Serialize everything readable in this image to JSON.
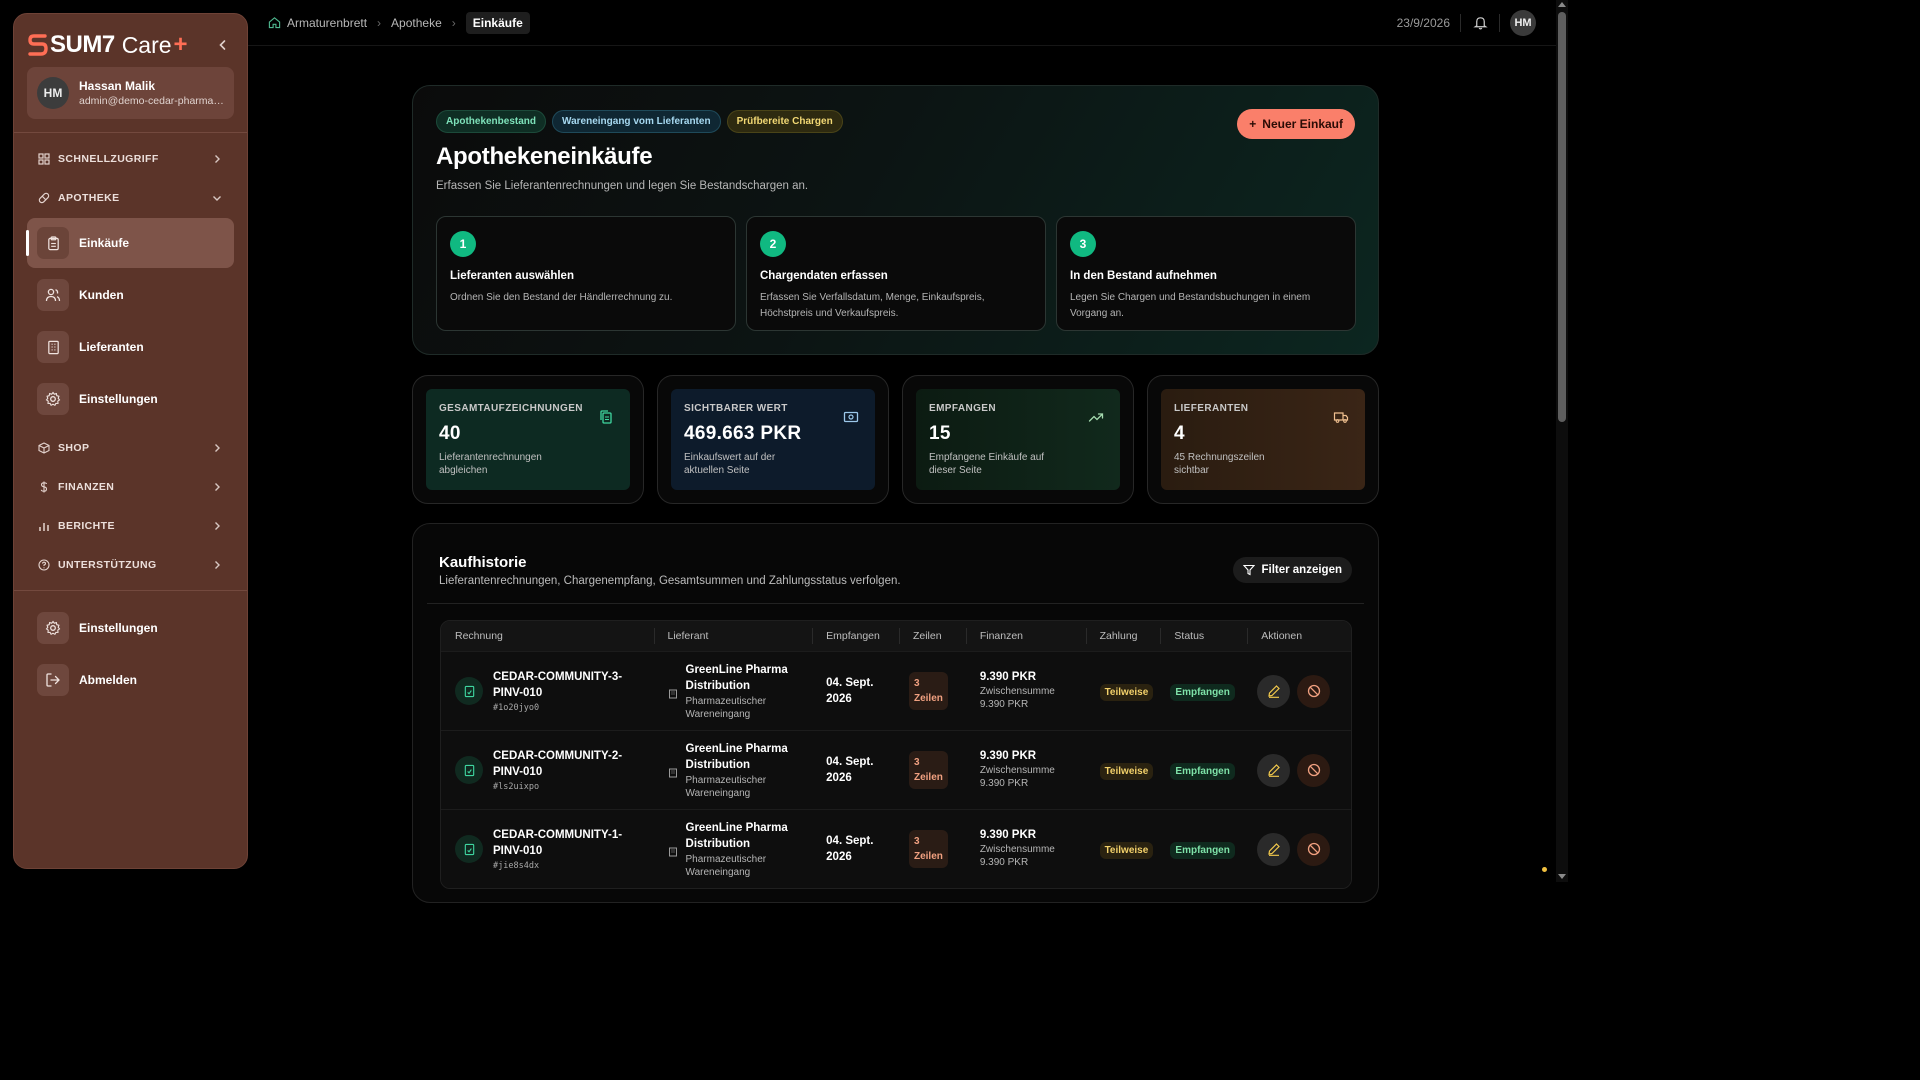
{
  "brand": {
    "name": "SUM7",
    "product": "Care",
    "plus": "+"
  },
  "user": {
    "initials": "HM",
    "name": "Hassan Malik",
    "email": "admin@demo-cedar-pharmacy...."
  },
  "sidebar": {
    "quick_access": "SCHNELLZUGRIFF",
    "pharmacy": "APOTHEKE",
    "pharmacy_items": [
      {
        "label": "Einkäufe",
        "icon": "clipboard-icon"
      },
      {
        "label": "Kunden",
        "icon": "users-icon"
      },
      {
        "label": "Lieferanten",
        "icon": "building-icon"
      },
      {
        "label": "Einstellungen",
        "icon": "gear-icon"
      }
    ],
    "sections": [
      "SHOP",
      "FINANZEN",
      "BERICHTE",
      "UNTERSTÜTZUNG"
    ],
    "bottom_items": [
      {
        "label": "Einstellungen",
        "icon": "gear-icon"
      },
      {
        "label": "Abmelden",
        "icon": "logout-icon"
      }
    ]
  },
  "breadcrumb": [
    "Armaturenbrett",
    "Apotheke",
    "Einkäufe"
  ],
  "topbar": {
    "date": "23/9/2026",
    "avatar": "HM"
  },
  "hero": {
    "chips": [
      "Apothekenbestand",
      "Wareneingang vom Lieferanten",
      "Prüfbereite Chargen"
    ],
    "title": "Apothekeneinkäufe",
    "subtitle": "Erfassen Sie Lieferantenrechnungen und legen Sie Bestandschargen an.",
    "new_button": "Neuer Einkauf",
    "steps": [
      {
        "num": "1",
        "title": "Lieferanten auswählen",
        "text": "Ordnen Sie den Bestand der Händlerrechnung zu."
      },
      {
        "num": "2",
        "title": "Chargendaten erfassen",
        "text": "Erfassen Sie Verfallsdatum, Menge, Einkaufspreis, Höchstpreis und Verkaufspreis."
      },
      {
        "num": "3",
        "title": "In den Bestand aufnehmen",
        "text": "Legen Sie Chargen und Bestandsbuchungen in einem Vorgang an."
      }
    ]
  },
  "stats": [
    {
      "label": "GESAMTAUFZEICHNUNGEN",
      "value": "40",
      "desc": "Lieferantenrechnungen abgleichen",
      "icon": "copy-icon"
    },
    {
      "label": "SICHTBARER WERT",
      "value": "469.663 PKR",
      "desc": "Einkaufswert auf der aktuellen Seite",
      "icon": "banknote-icon"
    },
    {
      "label": "EMPFANGEN",
      "value": "15",
      "desc": "Empfangene Einkäufe auf dieser Seite",
      "icon": "trend-up-icon"
    },
    {
      "label": "LIEFERANTEN",
      "value": "4",
      "desc": "45 Rechnungszeilen sichtbar",
      "icon": "truck-icon"
    }
  ],
  "history": {
    "title": "Kaufhistorie",
    "subtitle": "Lieferantenrechnungen, Chargenempfang, Gesamtsummen und Zahlungsstatus verfolgen.",
    "filter_button": "Filter anzeigen",
    "columns": [
      "Rechnung",
      "Lieferant",
      "Empfangen",
      "Zeilen",
      "Finanzen",
      "Zahlung",
      "Status",
      "Aktionen"
    ],
    "rows": [
      {
        "invoice_l1": "CEDAR-COMMUNITY-3-",
        "invoice_l2": "PINV-010",
        "id": "#1o20jyo0",
        "supplier_l1": "GreenLine Pharma",
        "supplier_l2": "Distribution",
        "type_l1": "Pharmazeutischer",
        "type_l2": "Wareneingang",
        "date_l1": "04. Sept.",
        "date_l2": "2026",
        "lines_l1": "3",
        "lines_l2": "Zeilen",
        "amount": "9.390 PKR",
        "sub_l1": "Zwischensumme",
        "sub_l2": "9.390 PKR",
        "payment": "Teilweise",
        "status": "Empfangen"
      },
      {
        "invoice_l1": "CEDAR-COMMUNITY-2-",
        "invoice_l2": "PINV-010",
        "id": "#ls2uixpo",
        "supplier_l1": "GreenLine Pharma",
        "supplier_l2": "Distribution",
        "type_l1": "Pharmazeutischer",
        "type_l2": "Wareneingang",
        "date_l1": "04. Sept.",
        "date_l2": "2026",
        "lines_l1": "3",
        "lines_l2": "Zeilen",
        "amount": "9.390 PKR",
        "sub_l1": "Zwischensumme",
        "sub_l2": "9.390 PKR",
        "payment": "Teilweise",
        "status": "Empfangen"
      },
      {
        "invoice_l1": "CEDAR-COMMUNITY-1-",
        "invoice_l2": "PINV-010",
        "id": "#jie8s4dx",
        "supplier_l1": "GreenLine Pharma",
        "supplier_l2": "Distribution",
        "type_l1": "Pharmazeutischer",
        "type_l2": "Wareneingang",
        "date_l1": "04. Sept.",
        "date_l2": "2026",
        "lines_l1": "3",
        "lines_l2": "Zeilen",
        "amount": "9.390 PKR",
        "sub_l1": "Zwischensumme",
        "sub_l2": "9.390 PKR",
        "payment": "Teilweise",
        "status": "Empfangen"
      }
    ]
  },
  "colors": {
    "accent": "#fa7f6a",
    "sidebar": "#5b3429",
    "success": "#10b981"
  }
}
